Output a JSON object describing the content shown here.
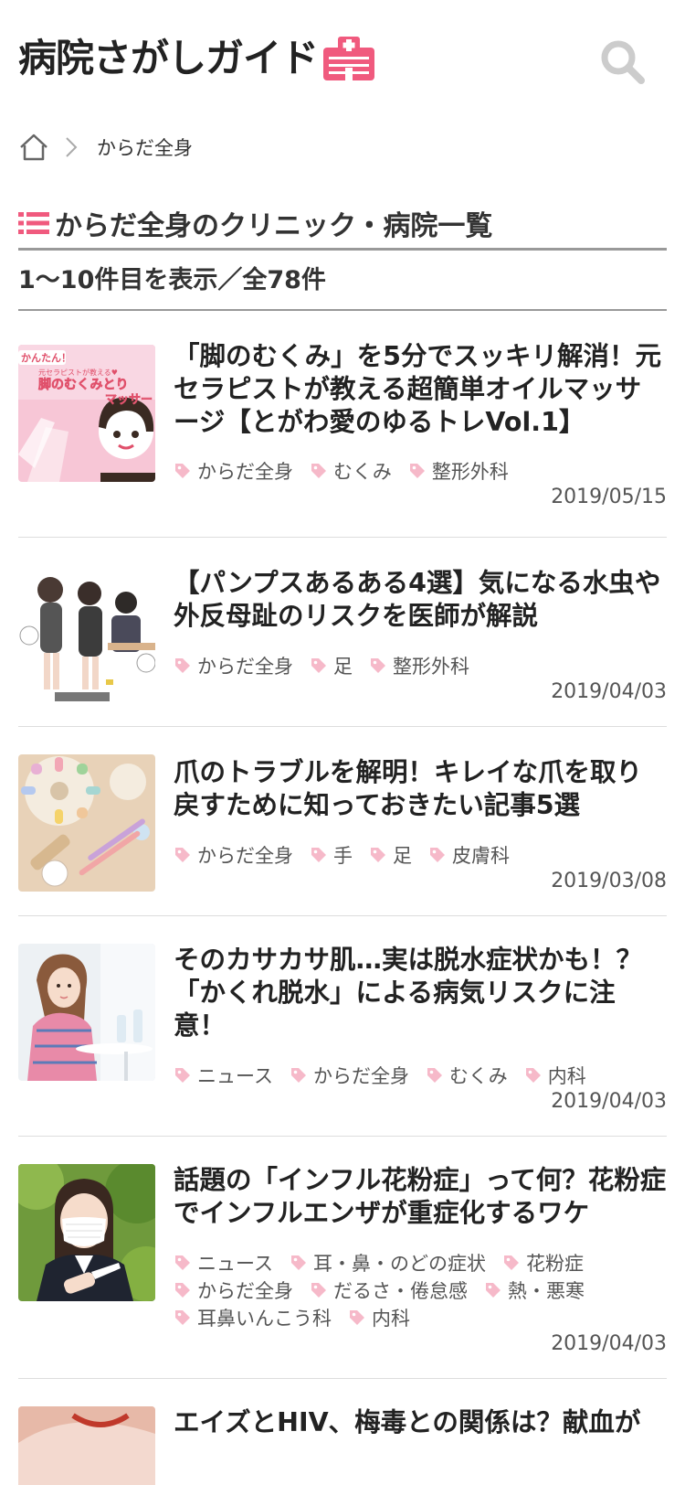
{
  "header": {
    "logo_text": "病院さがしガイド",
    "logo_icon": "hospital-building-icon",
    "search_icon": "search-icon"
  },
  "breadcrumb": {
    "home_icon": "home-icon",
    "separator_icon": "chevron-right-icon",
    "current": "からだ全身"
  },
  "section": {
    "list_icon": "list-icon",
    "title": "からだ全身のクリニック・病院一覧"
  },
  "count_text": "1〜10件目を表示／全78件",
  "articles": [
    {
      "title": "「脚のむくみ」を5分でスッキリ解消！元セラピストが教える超簡単オイルマッサージ【とがわ愛のゆるトレVol.1】",
      "tags": [
        "からだ全身",
        "むくみ",
        "整形外科"
      ],
      "date": "2019/05/15",
      "thumb_text_1": "かんたん！",
      "thumb_text_2": "元セラピストが教える♥",
      "thumb_text_3": "脚のむくみとり",
      "thumb_text_4": "マッサー"
    },
    {
      "title": "【パンプスあるある4選】気になる水虫や外反母趾のリスクを医師が解説",
      "tags": [
        "からだ全身",
        "足",
        "整形外科"
      ],
      "date": "2019/04/03"
    },
    {
      "title": "爪のトラブルを解明！キレイな爪を取り戻すために知っておきたい記事5選",
      "tags": [
        "からだ全身",
        "手",
        "足",
        "皮膚科"
      ],
      "date": "2019/03/08"
    },
    {
      "title": "そのカサカサ肌…実は脱水症状かも！？「かくれ脱水」による病気リスクに注意！",
      "tags": [
        "ニュース",
        "からだ全身",
        "むくみ",
        "内科"
      ],
      "date": "2019/04/03"
    },
    {
      "title": "話題の「インフル花粉症」って何？花粉症でインフルエンザが重症化するワケ",
      "tags": [
        "ニュース",
        "耳・鼻・のどの症状",
        "花粉症",
        "からだ全身",
        "だるさ・倦怠感",
        "熱・悪寒",
        "耳鼻いんこう科",
        "内科"
      ],
      "date": "2019/04/03"
    },
    {
      "title": "エイズとHIV、梅毒との関係は？献血が",
      "tags": [],
      "date": ""
    }
  ],
  "colors": {
    "accent_pink": "#f05a7e",
    "tag_icon_pink": "#f6b9c9",
    "rule_gray": "#999999",
    "search_gray": "#cccccc"
  }
}
